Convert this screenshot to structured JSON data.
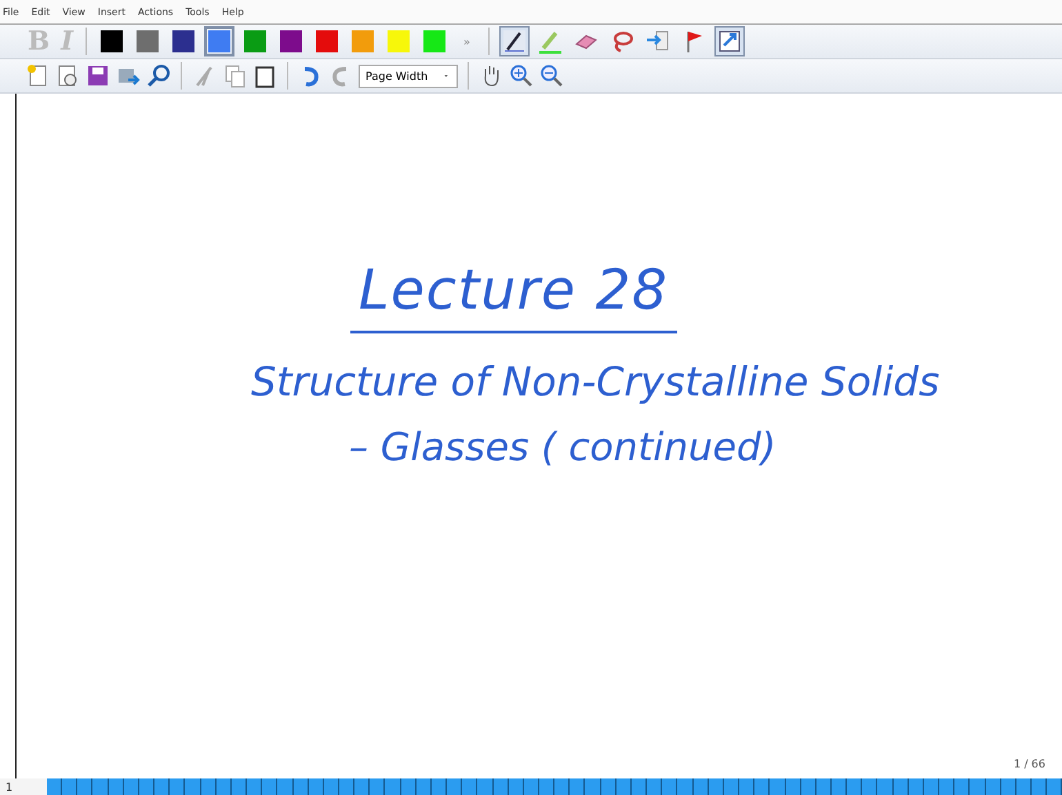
{
  "menu": [
    "File",
    "Edit",
    "View",
    "Insert",
    "Actions",
    "Tools",
    "Help"
  ],
  "format_buttons": [
    {
      "label": "B",
      "disabled": true
    },
    {
      "label": "I",
      "disabled": true
    }
  ],
  "pen_colors": [
    {
      "color": "#000000",
      "selected": false
    },
    {
      "color": "#6e6e6e",
      "selected": false
    },
    {
      "color": "#2c2f8f",
      "selected": false
    },
    {
      "color": "#3f7cf2",
      "selected": true
    },
    {
      "color": "#0a9c14",
      "selected": false
    },
    {
      "color": "#7d0c8c",
      "selected": false
    },
    {
      "color": "#e40c0c",
      "selected": false
    },
    {
      "color": "#f29c0c",
      "selected": false
    },
    {
      "color": "#f7f70a",
      "selected": false
    },
    {
      "color": "#16e816",
      "selected": false
    }
  ],
  "overflow": "»",
  "tools": [
    {
      "kind": "pen",
      "selected": true
    },
    {
      "kind": "highlighter",
      "selected": false
    },
    {
      "kind": "eraser",
      "selected": false
    },
    {
      "kind": "lasso",
      "selected": false
    },
    {
      "kind": "insert",
      "selected": false
    },
    {
      "kind": "flag",
      "selected": false
    },
    {
      "kind": "select",
      "selected": true
    }
  ],
  "zoom": {
    "value": "Page Width"
  },
  "ink_lines": [
    {
      "text": "Lecture 28",
      "underlined": true
    },
    {
      "text": "Structure of Non-Crystalline Solids",
      "underlined": false
    },
    {
      "text": "– Glasses ( continued)",
      "underlined": false
    }
  ],
  "page_counter": "1 / 66",
  "page_strip": {
    "label": "1"
  }
}
